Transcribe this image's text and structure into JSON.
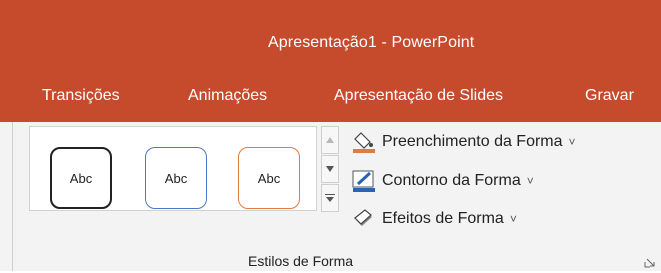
{
  "window": {
    "title": "Apresentação1  -  PowerPoint"
  },
  "tabs": [
    "Transições",
    "Animações",
    "Apresentação de Slides",
    "Gravar"
  ],
  "shape_styles": {
    "gallery_items": [
      {
        "label": "Abc",
        "outline_color": "#222222"
      },
      {
        "label": "Abc",
        "outline_color": "#4c78c7"
      },
      {
        "label": "Abc",
        "outline_color": "#e07c3e"
      }
    ],
    "commands": {
      "fill": {
        "label": "Preenchimento da Forma",
        "icon": "paint-bucket-icon"
      },
      "outline": {
        "label": "Contorno da Forma",
        "icon": "pen-outline-icon"
      },
      "effects": {
        "label": "Efeitos de Forma",
        "icon": "shape-effects-icon"
      }
    },
    "group_label": "Estilos de Forma"
  },
  "colors": {
    "ribbon_accent": "#c64b2d",
    "ribbon_background": "#f3f3f3"
  }
}
